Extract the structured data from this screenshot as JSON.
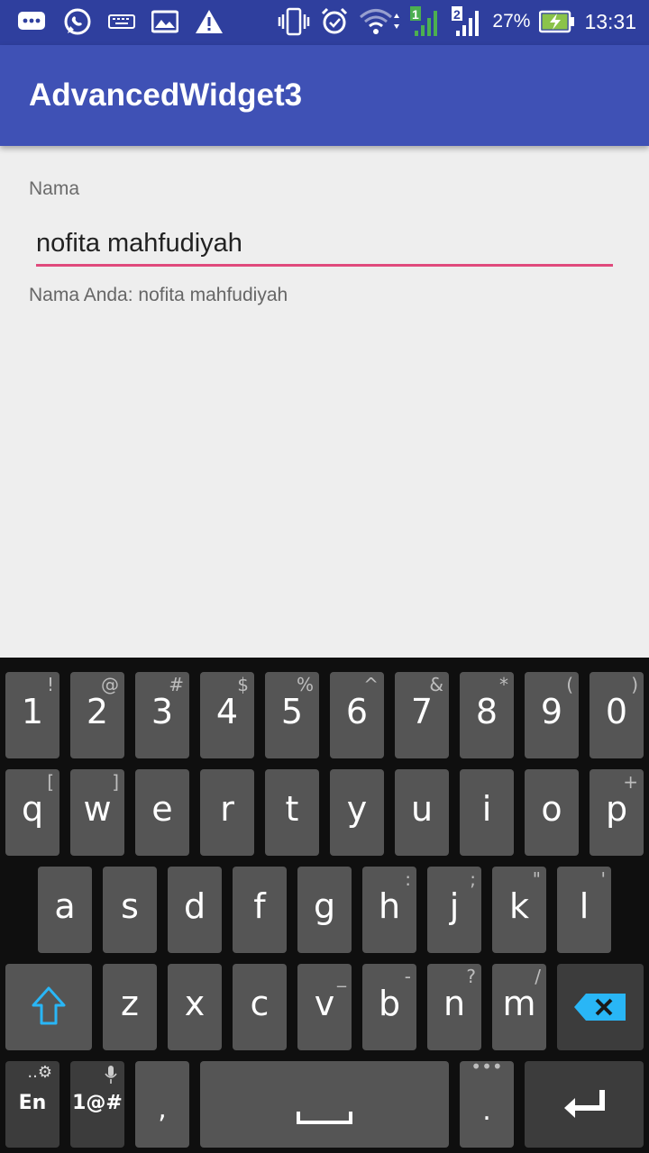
{
  "status_bar": {
    "battery_percent": "27%",
    "time": "13:31",
    "sim1": "1",
    "sim2": "2"
  },
  "app": {
    "title": "AdvancedWidget3"
  },
  "form": {
    "name_label": "Nama",
    "name_value": "nofita mahfudiyah",
    "result_text": "Nama Anda: nofita mahfudiyah",
    "accent_color": "#e04a7c"
  },
  "keyboard": {
    "row1": [
      {
        "main": "1",
        "sup": "!"
      },
      {
        "main": "2",
        "sup": "@"
      },
      {
        "main": "3",
        "sup": "#"
      },
      {
        "main": "4",
        "sup": "$"
      },
      {
        "main": "5",
        "sup": "%"
      },
      {
        "main": "6",
        "sup": "^"
      },
      {
        "main": "7",
        "sup": "&"
      },
      {
        "main": "8",
        "sup": "*"
      },
      {
        "main": "9",
        "sup": "("
      },
      {
        "main": "0",
        "sup": ")"
      }
    ],
    "row2": [
      {
        "main": "q",
        "sup": "["
      },
      {
        "main": "w",
        "sup": "]"
      },
      {
        "main": "e",
        "sup": ""
      },
      {
        "main": "r",
        "sup": ""
      },
      {
        "main": "t",
        "sup": ""
      },
      {
        "main": "y",
        "sup": ""
      },
      {
        "main": "u",
        "sup": ""
      },
      {
        "main": "i",
        "sup": ""
      },
      {
        "main": "o",
        "sup": ""
      },
      {
        "main": "p",
        "sup": "+"
      }
    ],
    "row3": [
      {
        "main": "a",
        "sup": ""
      },
      {
        "main": "s",
        "sup": ""
      },
      {
        "main": "d",
        "sup": ""
      },
      {
        "main": "f",
        "sup": ""
      },
      {
        "main": "g",
        "sup": ""
      },
      {
        "main": "h",
        "sup": ":"
      },
      {
        "main": "j",
        "sup": ";"
      },
      {
        "main": "k",
        "sup": "\""
      },
      {
        "main": "l",
        "sup": "'"
      }
    ],
    "row4": [
      {
        "main": "z",
        "sup": ""
      },
      {
        "main": "x",
        "sup": ""
      },
      {
        "main": "c",
        "sup": ""
      },
      {
        "main": "v",
        "sup": "_"
      },
      {
        "main": "b",
        "sup": "-"
      },
      {
        "main": "n",
        "sup": "?"
      },
      {
        "main": "m",
        "sup": "/"
      }
    ],
    "lang_label": "En",
    "symbols_label": "1@#",
    "comma": ",",
    "period": "."
  }
}
